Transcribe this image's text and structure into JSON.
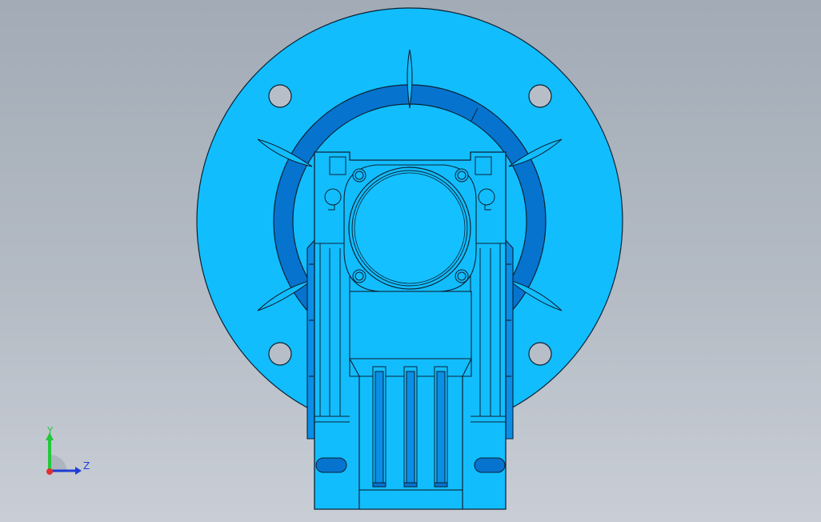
{
  "viewport": {
    "background_top": "#a2abb6",
    "background_bottom": "#c9ced6"
  },
  "model": {
    "primary_color": "#12bdfe",
    "shade_color": "#0a8ee6",
    "deep_shade_color": "#0673cf",
    "edge_color": "#0b2233"
  },
  "triad": {
    "y_label": "Y",
    "z_label": "Z",
    "y_color": "#22c83a",
    "z_color": "#1f3ed6",
    "x_color": "#e23030"
  }
}
